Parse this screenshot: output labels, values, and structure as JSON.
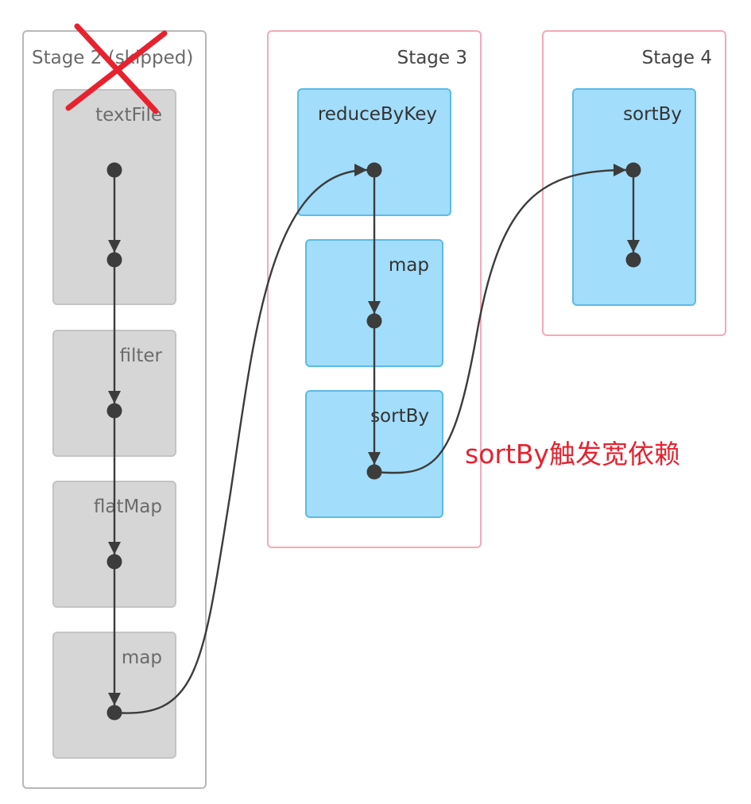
{
  "stages": [
    {
      "id": "stage2",
      "title": "Stage 2 (skipped)",
      "status": "skipped",
      "ops": [
        {
          "label": "textFile"
        },
        {
          "label": "filter"
        },
        {
          "label": "flatMap"
        },
        {
          "label": "map"
        }
      ]
    },
    {
      "id": "stage3",
      "title": "Stage 3",
      "status": "active",
      "ops": [
        {
          "label": "reduceByKey"
        },
        {
          "label": "map"
        },
        {
          "label": "sortBy"
        }
      ]
    },
    {
      "id": "stage4",
      "title": "Stage 4",
      "status": "active",
      "ops": [
        {
          "label": "sortBy"
        }
      ]
    }
  ],
  "annotation": "sortBy触发宽依赖",
  "colors": {
    "skipped_fill": "#d6d6d6",
    "active_fill": "#a2ddfb",
    "active_stage_border": "#f4a9b6",
    "skipped_stage_border": "#b8b8b8",
    "node": "#3c3c3c",
    "annotation": "#e8212e",
    "cross": "#e8212e"
  },
  "icons": {
    "skipped_mark": "red-x-cross-icon"
  }
}
